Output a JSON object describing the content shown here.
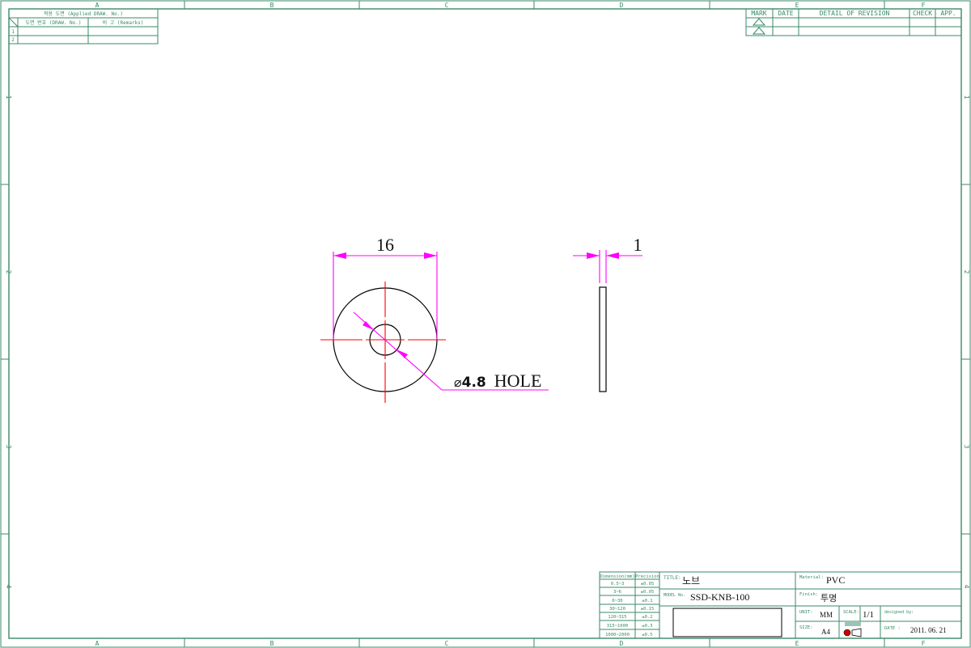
{
  "frame": {
    "col_labels": [
      "A",
      "B",
      "C",
      "D",
      "E",
      "F"
    ],
    "row_labels": [
      "1",
      "2",
      "3",
      "4"
    ]
  },
  "applied_table": {
    "header": "적용 도면 (Applied DRAW. No.)",
    "col1": "도면 번호 (DRAW. No.)",
    "col2": "비 고 (Remarks)",
    "rows": [
      "1",
      "2"
    ]
  },
  "revision_table": {
    "headers": [
      "MARK",
      "DATE",
      "DETAIL OF REVISION",
      "CHECK",
      "APP."
    ]
  },
  "drawing": {
    "outer_dimension": "16",
    "thickness_dimension": "1",
    "hole_symbol": "⌀",
    "hole_size": "4.8",
    "hole_word": "HOLE"
  },
  "tolerance_table": {
    "headers": [
      "Dimension(mm)",
      "Precision"
    ],
    "rows": [
      [
        "0.5~3",
        "±0.05"
      ],
      [
        "3~6",
        "±0.05"
      ],
      [
        "6~30",
        "±0.1"
      ],
      [
        "30~120",
        "±0.15"
      ],
      [
        "120~315",
        "±0.2"
      ],
      [
        "315~1000",
        "±0.3"
      ],
      [
        "1000~2000",
        "±0.5"
      ]
    ]
  },
  "title_block": {
    "title_label": "TITLE:",
    "title_value": "노브",
    "model_label": "MODEL No.",
    "model_value": "SSD-KNB-100",
    "material_label": "Material:",
    "material_value": "PVC",
    "finish_label": "Finish:",
    "finish_value": "투명",
    "unit_label": "UNIT:",
    "unit_value": "MM",
    "scale_label": "SCALE:",
    "scale_value": "1/1",
    "designed_label": "designed by:",
    "size_label": "SIZE:",
    "size_value": "A4",
    "date_label": "DATE :",
    "date_value": "2011. 06. 21"
  }
}
